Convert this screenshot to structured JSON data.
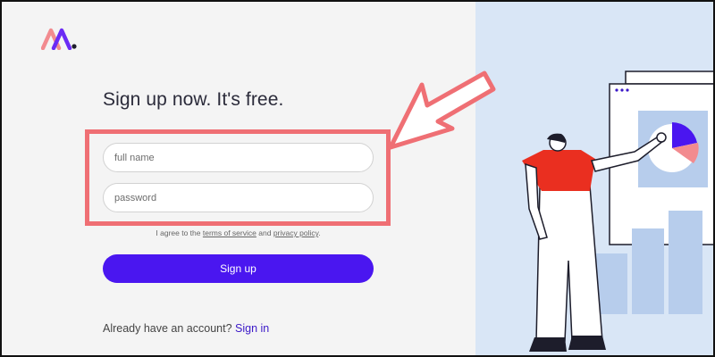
{
  "colors": {
    "accent": "#4a16f0",
    "highlight": "#ef6f74",
    "illustration_bg": "#d9e6f6",
    "link": "#3b19c8"
  },
  "headline": "Sign up now. It's free.",
  "form": {
    "full_name_placeholder": "full name",
    "password_placeholder": "password",
    "agree_prefix": "I agree to the",
    "terms_link": "terms of service",
    "agree_and": "and",
    "privacy_link": "privacy policy",
    "agree_suffix": ".",
    "signup_label": "Sign up"
  },
  "signin": {
    "prompt": "Already have an account?",
    "link": "Sign in"
  },
  "icons": {
    "logo": "brand-logo-icon",
    "annotation": "red-arrow-icon",
    "illustration": "person-presenting-chart-illustration"
  }
}
